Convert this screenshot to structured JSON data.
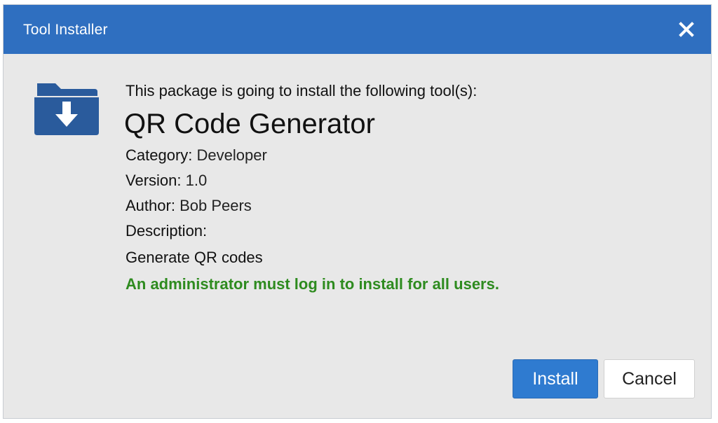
{
  "window": {
    "title": "Tool Installer",
    "close_icon": "close-icon",
    "titlebar_color": "#2f6fc0"
  },
  "main": {
    "icon": "folder-download-icon",
    "intro": "This package is going to install the following tool(s):",
    "tool_name": "QR Code Generator",
    "category_label": "Category:",
    "category_value": "Developer",
    "version_label": "Version:",
    "version_value": "1.0",
    "author_label": "Author:",
    "author_value": "Bob Peers",
    "description_label": "Description:",
    "description_value": "Generate QR codes",
    "notice": "An administrator must log in to install for all users.",
    "notice_color": "#2e8b1f"
  },
  "buttons": {
    "install": "Install",
    "cancel": "Cancel",
    "install_color": "#2f7bd0"
  }
}
